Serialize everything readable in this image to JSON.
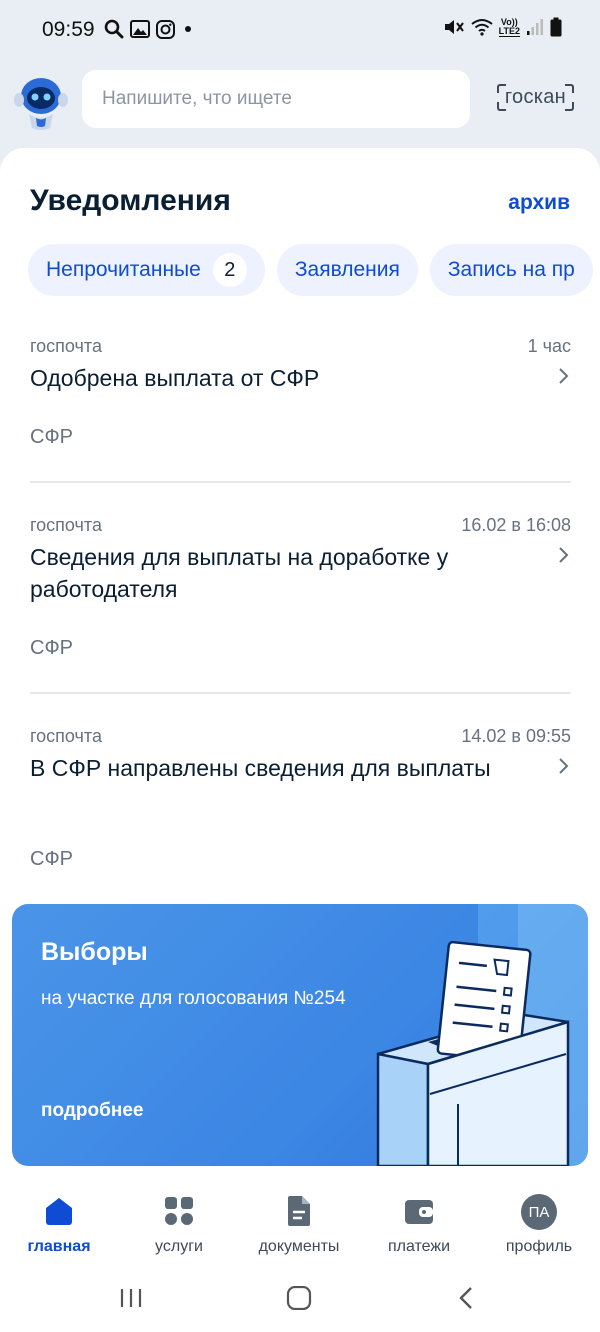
{
  "status_bar": {
    "time": "09:59",
    "left_icons": [
      "search-icon",
      "gallery-icon",
      "instagram-icon",
      "dot-icon"
    ],
    "right_icons": [
      "mute-icon",
      "wifi-icon",
      "volte-lte2-icon",
      "signal-icon",
      "battery-icon"
    ],
    "network_label": "Vo))",
    "network_label2": "LTE2"
  },
  "header": {
    "search_placeholder": "Напишите, что ищете",
    "goscan_label": "госкан"
  },
  "notifications": {
    "title": "Уведомления",
    "archive_label": "архив",
    "chips": [
      {
        "label": "Непрочитанные",
        "badge": "2"
      },
      {
        "label": "Заявления"
      },
      {
        "label": "Запись на пр"
      }
    ],
    "items": [
      {
        "source": "госпочта",
        "time": "1 час",
        "title": "Одобрена выплата от СФР",
        "org": "СФР"
      },
      {
        "source": "госпочта",
        "time": "16.02 в 16:08",
        "title": "Сведения для выплаты на доработке у работодателя",
        "org": "СФР"
      },
      {
        "source": "госпочта",
        "time": "14.02 в 09:55",
        "title": "В СФР направлены сведения для выплаты",
        "org": "СФР"
      }
    ]
  },
  "promo": {
    "title": "Выборы",
    "subtitle": "на участке для голосования №254",
    "link": "подробнее"
  },
  "bottom_nav": {
    "items": [
      {
        "label": "главная",
        "icon": "home-icon",
        "active": true
      },
      {
        "label": "услуги",
        "icon": "services-grid-icon"
      },
      {
        "label": "документы",
        "icon": "document-icon"
      },
      {
        "label": "платежи",
        "icon": "wallet-icon"
      },
      {
        "label": "профиль",
        "icon": "avatar",
        "initials": "ПА"
      }
    ]
  },
  "colors": {
    "accent": "#0d4cd3",
    "chip_bg": "#edf2fe",
    "promo_bg": "#3c86e4",
    "page_bg": "#e9eef5"
  }
}
